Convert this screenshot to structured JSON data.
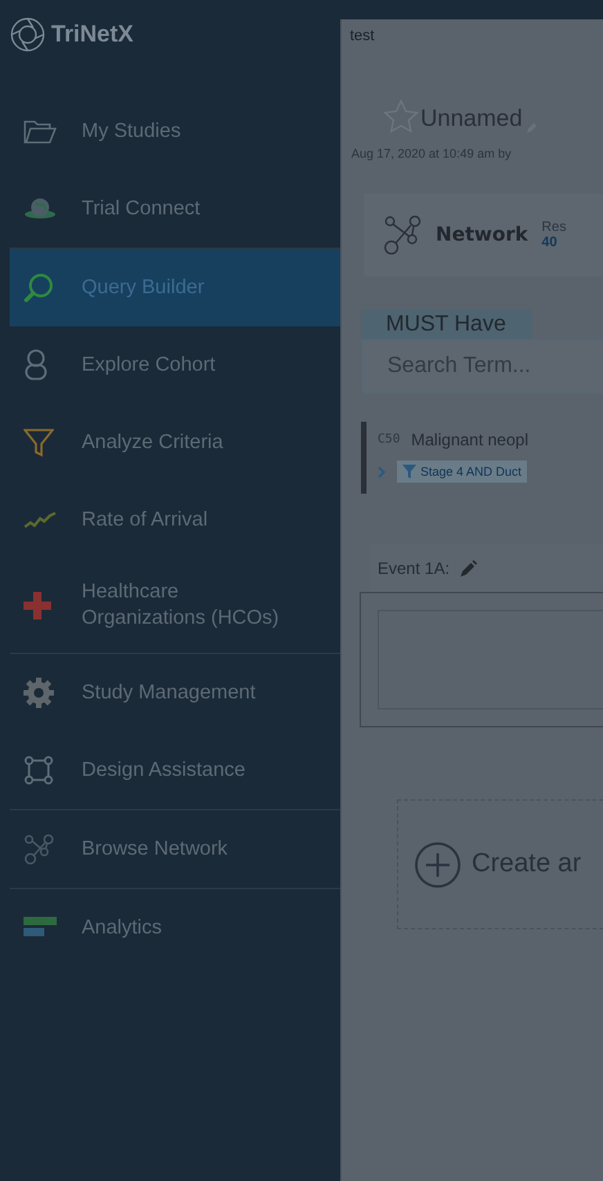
{
  "sidebar": {
    "logo": "TriNetX",
    "sections": [
      [
        {
          "label": "My Studies",
          "selected": false
        },
        {
          "label": "Trial Connect",
          "selected": false
        }
      ],
      [
        {
          "label": "Query Builder",
          "selected": true
        },
        {
          "label": "Explore Cohort",
          "selected": false
        },
        {
          "label": "Analyze Criteria",
          "selected": false
        },
        {
          "label": "Rate of Arrival",
          "selected": false
        },
        {
          "label": "Healthcare Organizations (HCOs)",
          "selected": false
        }
      ],
      [
        {
          "label": "Study Management",
          "selected": false
        },
        {
          "label": "Design Assistance",
          "selected": false
        }
      ],
      [
        {
          "label": "Browse Network",
          "selected": false
        }
      ],
      [
        {
          "label": "Analytics",
          "selected": false
        }
      ]
    ]
  },
  "main": {
    "breadcrumb": "test",
    "study_title": "Unnamed",
    "meta": "Aug 17, 2020 at 10:49 am by",
    "network": {
      "label": "Network",
      "results_label": "Res",
      "results_value": "40"
    },
    "criteria_tab": "MUST Have",
    "search": {
      "placeholder": "Search Term..."
    },
    "criterion": {
      "code": "C50",
      "name": "Malignant neopl",
      "filter": "Stage 4 AND Duct"
    },
    "event": {
      "label": "Event 1A:"
    },
    "create": "Create ar"
  }
}
